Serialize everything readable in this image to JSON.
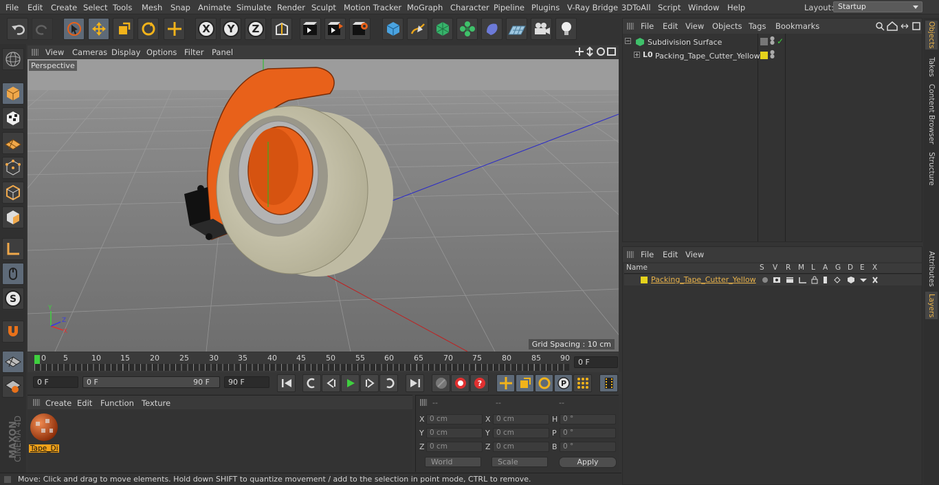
{
  "menubar": {
    "items": [
      "File",
      "Edit",
      "Create",
      "Select",
      "Tools",
      "Mesh",
      "Snap",
      "Animate",
      "Simulate",
      "Render",
      "Sculpt",
      "Motion Tracker",
      "MoGraph",
      "Character",
      "Pipeline",
      "Plugins",
      "V-Ray Bridge",
      "3DToAll",
      "Script",
      "Window",
      "Help"
    ],
    "layout_label": "Layout:",
    "layout_value": "Startup"
  },
  "toolbar": {
    "icons": [
      "undo-icon",
      "redo-icon",
      "select-arrow-icon",
      "move-icon",
      "scale-icon",
      "rotate-icon",
      "move-add-icon",
      "x-axis-icon",
      "y-axis-icon",
      "z-axis-icon",
      "world-coords-icon",
      "render-view-icon",
      "render-pv-icon",
      "render-settings-icon",
      "cube-icon",
      "pen-icon",
      "subdivision-icon",
      "mograph-cloner-icon",
      "deformer-icon",
      "floor-icon",
      "camera-icon",
      "light-icon"
    ]
  },
  "viewport": {
    "menu": [
      "View",
      "Cameras",
      "Display",
      "Options",
      "Filter",
      "Panel"
    ],
    "perspective_label": "Perspective",
    "grid_spacing": "Grid Spacing : 10 cm"
  },
  "timeline": {
    "ticks": [
      "0",
      "5",
      "10",
      "15",
      "20",
      "25",
      "30",
      "35",
      "40",
      "45",
      "50",
      "55",
      "60",
      "65",
      "70",
      "75",
      "80",
      "85",
      "90"
    ],
    "end_frame_field": "0 F"
  },
  "playback": {
    "current_frame": "0 F",
    "range_start": "0 F",
    "range_end": "90 F",
    "max_frame": "90 F"
  },
  "materials": {
    "menu": [
      "Create",
      "Edit",
      "Function",
      "Texture"
    ],
    "material_name": "Tape_Di"
  },
  "coordinates": {
    "headers": [
      "--",
      "--",
      "--"
    ],
    "rows": [
      {
        "l1": "X",
        "v1": "0 cm",
        "l2": "X",
        "v2": "0 cm",
        "l3": "H",
        "v3": "0 °"
      },
      {
        "l1": "Y",
        "v1": "0 cm",
        "l2": "Y",
        "v2": "0 cm",
        "l3": "P",
        "v3": "0 °"
      },
      {
        "l1": "Z",
        "v1": "0 cm",
        "l2": "Z",
        "v2": "0 cm",
        "l3": "B",
        "v3": "0 °"
      }
    ],
    "coord_system": "World",
    "mode": "Scale",
    "apply_label": "Apply"
  },
  "status": {
    "text": "Move: Click and drag to move elements. Hold down SHIFT to quantize movement / add to the selection in point mode, CTRL to remove."
  },
  "objects_panel": {
    "menu": [
      "File",
      "Edit",
      "View",
      "Objects",
      "Tags",
      "Bookmarks"
    ],
    "items": [
      {
        "name": "Subdivision Surface"
      },
      {
        "name": "Packing_Tape_Cutter_Yellow"
      }
    ]
  },
  "layers_panel": {
    "menu": [
      "File",
      "Edit",
      "View"
    ],
    "headers": [
      "Name",
      "S",
      "V",
      "R",
      "M",
      "L",
      "A",
      "G",
      "D",
      "E",
      "X"
    ],
    "layer_name": "Packing_Tape_Cutter_Yellow",
    "layer_color": "#e5d21c"
  },
  "right_tabs": [
    "Objects",
    "Takes",
    "Content Browser",
    "Structure",
    "Attributes",
    "Layers"
  ],
  "brand": {
    "line1": "MAXON",
    "line2": "CINEMA 4D"
  },
  "colors": {
    "accent": "#e8b24a",
    "selected": "#5e6a78",
    "orange": "#e8611a"
  }
}
